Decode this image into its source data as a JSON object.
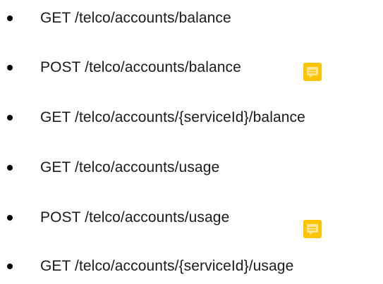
{
  "endpoints": [
    {
      "text": "GET /telco/accounts/balance",
      "has_comment": false
    },
    {
      "text": "POST /telco/accounts/balance",
      "has_comment": true
    },
    {
      "text": "GET /telco/accounts/{serviceId}/balance",
      "has_comment": false
    },
    {
      "text": "GET /telco/accounts/usage",
      "has_comment": false
    },
    {
      "text": "POST /telco/accounts/usage",
      "has_comment": true
    },
    {
      "text": "GET /telco/accounts/{serviceId}/usage",
      "has_comment": false
    }
  ],
  "colors": {
    "comment_icon": "#ffc400",
    "bullet": "#000000",
    "text": "#1a1a1a"
  },
  "icons": {
    "comment": "comment-note-icon"
  }
}
